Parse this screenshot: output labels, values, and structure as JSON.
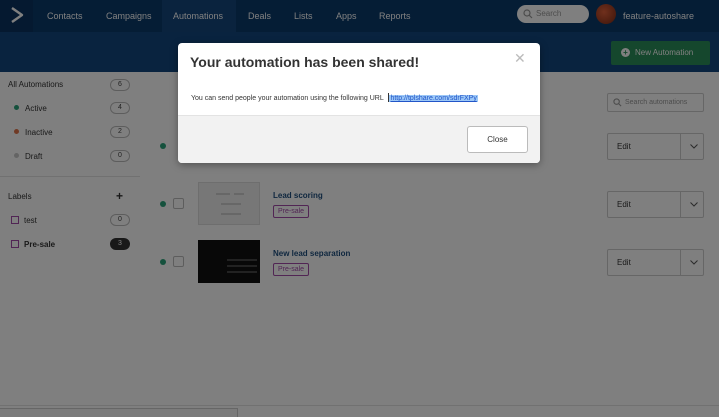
{
  "nav": {
    "items": [
      "Contacts",
      "Campaigns",
      "Automations",
      "Deals",
      "Lists",
      "Apps",
      "Reports"
    ],
    "search_placeholder": "Search",
    "account_name": "feature-autoshare"
  },
  "header": {
    "new_automation_label": "New Automation"
  },
  "sidebar": {
    "all_label": "All Automations",
    "all_count": "6",
    "statuses": [
      {
        "label": "Active",
        "count": "4",
        "color": "#2aa37a"
      },
      {
        "label": "Inactive",
        "count": "2",
        "color": "#e0744a"
      },
      {
        "label": "Draft",
        "count": "0",
        "color": "#c8c8c8"
      }
    ],
    "labels_heading": "Labels",
    "labels": [
      {
        "label": "test",
        "count": "0"
      },
      {
        "label": "Pre-sale",
        "count": "3"
      }
    ]
  },
  "main": {
    "search_placeholder": "Search automations",
    "rows": [
      {
        "title": "",
        "tag": "",
        "edit": "Edit"
      },
      {
        "title": "Lead scoring",
        "tag": "Pre-sale",
        "edit": "Edit"
      },
      {
        "title": "New lead separation",
        "tag": "Pre-sale",
        "edit": "Edit"
      }
    ]
  },
  "modal": {
    "title": "Your automation has been shared!",
    "body_text": "You can send people your automation using the following URL",
    "url": "http://tplshare.com/sdrFXPy",
    "close_label": "Close"
  },
  "colors": {
    "nav_bg": "#0b3a6b",
    "accent_green": "#2b8f5a",
    "label_purple": "#a24aa8",
    "link_blue": "#2255c8"
  }
}
